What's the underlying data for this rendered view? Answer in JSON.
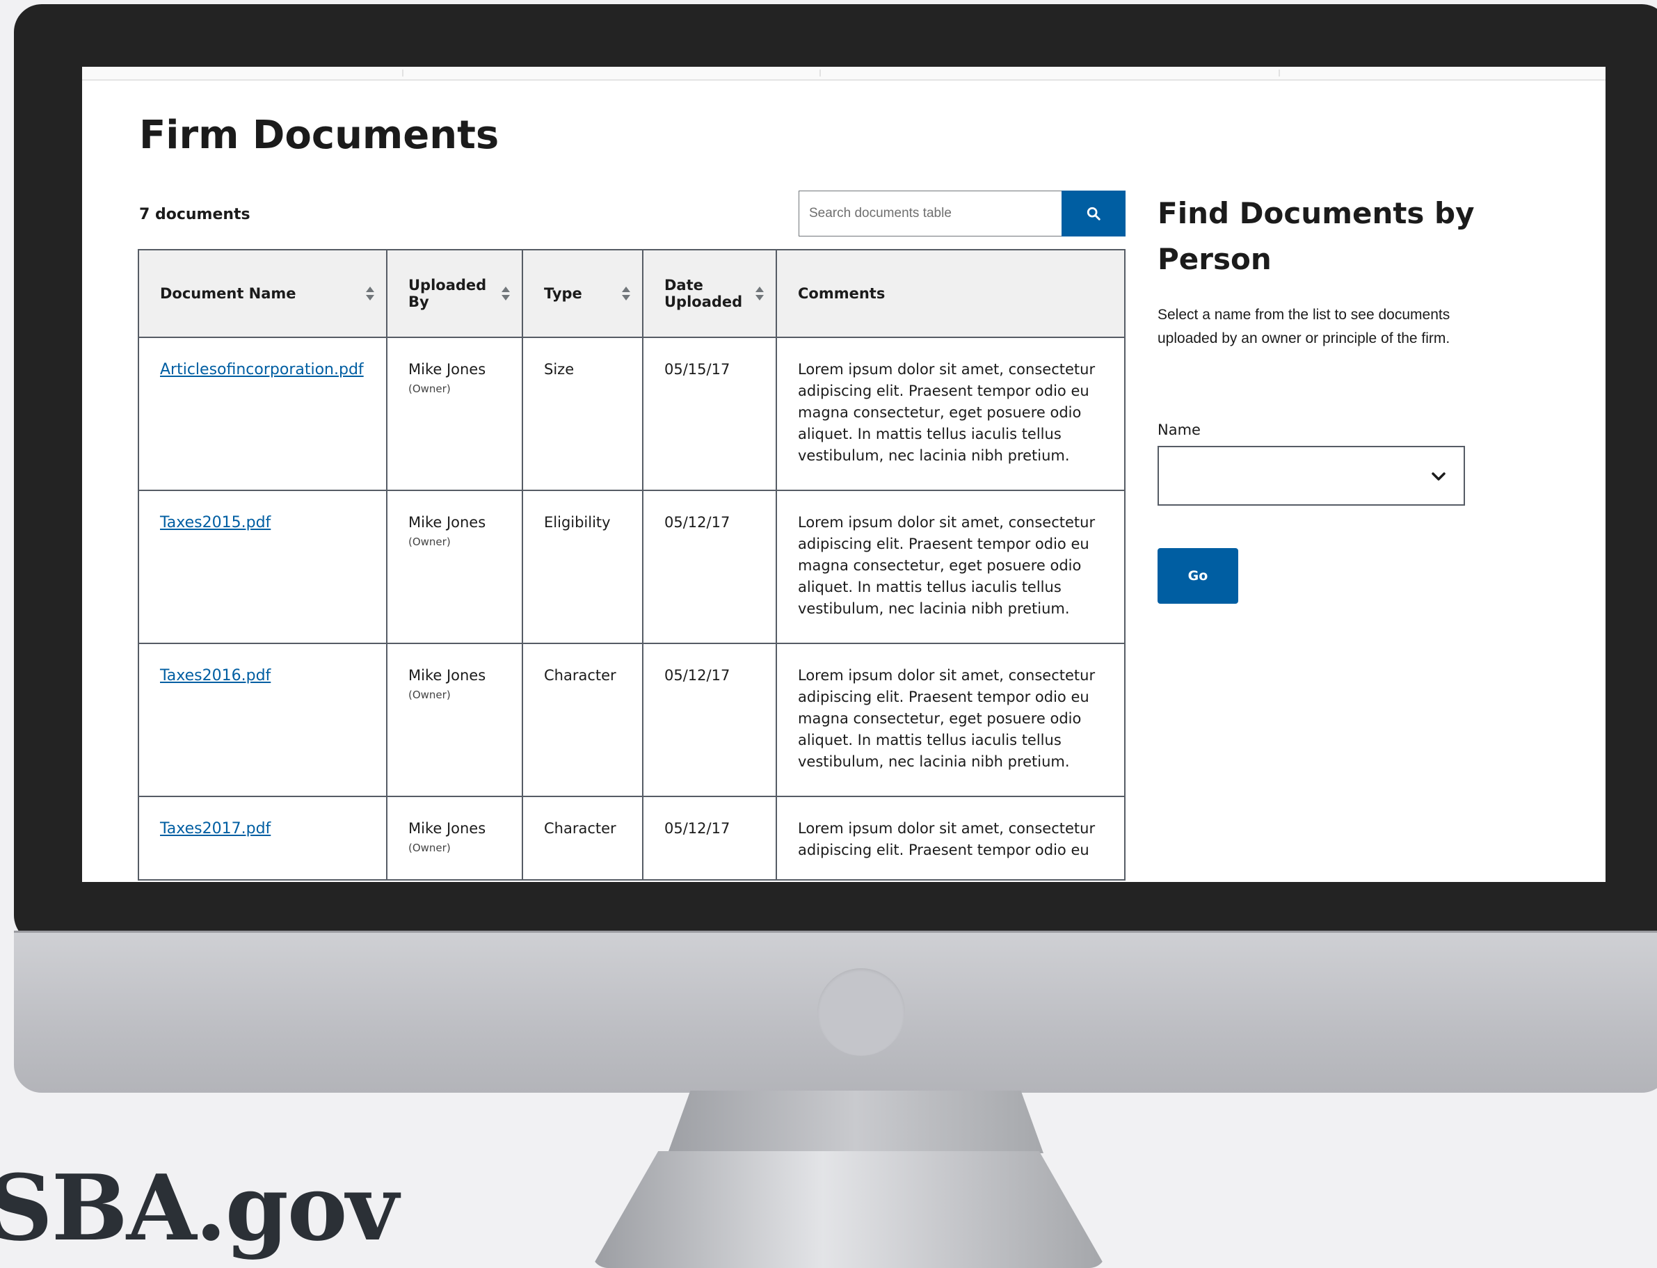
{
  "page": {
    "title": "Firm Documents",
    "doc_count": "7 documents"
  },
  "search": {
    "placeholder": "Search documents table",
    "button_icon": "search-icon"
  },
  "table": {
    "headers": [
      "Document Name",
      "Uploaded By",
      "Type",
      "Date Uploaded",
      "Comments"
    ],
    "rows": [
      {
        "name": "Articlesofincorporation.pdf",
        "uploader": "Mike Jones",
        "role": "(Owner)",
        "type": "Size",
        "date": "05/15/17",
        "comment": "Lorem ipsum dolor sit amet, consectetur adipiscing elit. Praesent tempor odio eu magna consectetur, eget posuere odio aliquet. In mattis tellus iaculis tellus vestibulum, nec lacinia nibh pretium."
      },
      {
        "name": "Taxes2015.pdf",
        "uploader": "Mike Jones",
        "role": "(Owner)",
        "type": "Eligibility",
        "date": "05/12/17",
        "comment": "Lorem ipsum dolor sit amet, consectetur adipiscing elit. Praesent tempor odio eu magna consectetur, eget posuere odio aliquet. In mattis tellus iaculis tellus vestibulum, nec lacinia nibh pretium."
      },
      {
        "name": "Taxes2016.pdf",
        "uploader": "Mike Jones",
        "role": "(Owner)",
        "type": "Character",
        "date": "05/12/17",
        "comment": "Lorem ipsum dolor sit amet, consectetur adipiscing elit. Praesent tempor odio eu magna consectetur, eget posuere odio aliquet. In mattis tellus iaculis tellus vestibulum, nec lacinia nibh pretium."
      },
      {
        "name": "Taxes2017.pdf",
        "uploader": "Mike Jones",
        "role": "(Owner)",
        "type": "Character",
        "date": "05/12/17",
        "comment": "Lorem ipsum dolor sit amet, consectetur adipiscing elit. Praesent tempor odio eu"
      }
    ]
  },
  "sidebar": {
    "title": "Find Documents by Person",
    "help": "Select a name from the list to see documents uploaded by an owner or principle of the firm.",
    "name_label": "Name",
    "name_value": "",
    "go_label": "Go"
  },
  "brand": {
    "logo_text": "SBA.gov"
  },
  "colors": {
    "primary": "#005ea2",
    "bezel": "#232323",
    "background": "#f1f1f3"
  }
}
